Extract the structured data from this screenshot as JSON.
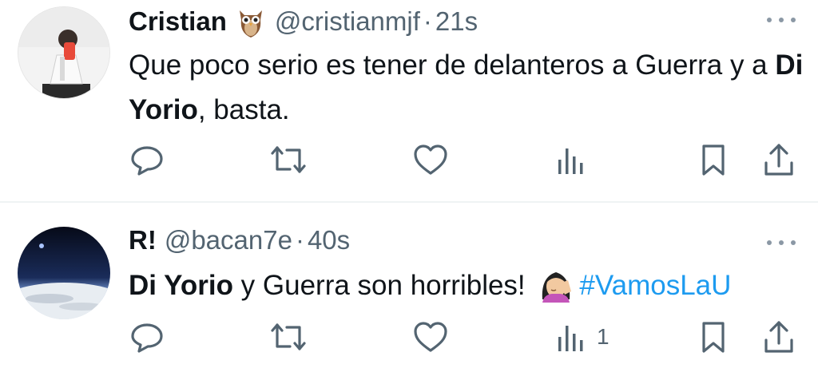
{
  "tweets": [
    {
      "name": "Cristian",
      "name_emoji": "owl-emoji",
      "handle": "@cristianmjf",
      "separator": "·",
      "time": "21s",
      "text_part1": "Que poco serio es tener de delanteros  a Guerra y a ",
      "text_bold": "Di Yorio",
      "text_part2": ", basta.",
      "avatar": "profile-photo",
      "views_count": ""
    },
    {
      "name": "R!",
      "handle": "@bacan7e",
      "separator": "·",
      "time": "40s",
      "text_bold": "Di Yorio",
      "text_part1": " y Guerra son horribles! ",
      "text_emoji": "woman-facepalming-emoji",
      "hashtag": "#VamosLaU",
      "avatar": "planet-horizon-photo",
      "views_count": "1"
    }
  ],
  "icons": {
    "reply": "reply-icon",
    "retweet": "retweet-icon",
    "like": "heart-icon",
    "views": "views-icon",
    "bookmark": "bookmark-icon",
    "share": "share-icon",
    "more": "more-icon"
  },
  "colors": {
    "text": "#0f1419",
    "secondary": "#536471",
    "hashtag": "#1d9bf0",
    "divider": "#eff3f4"
  }
}
